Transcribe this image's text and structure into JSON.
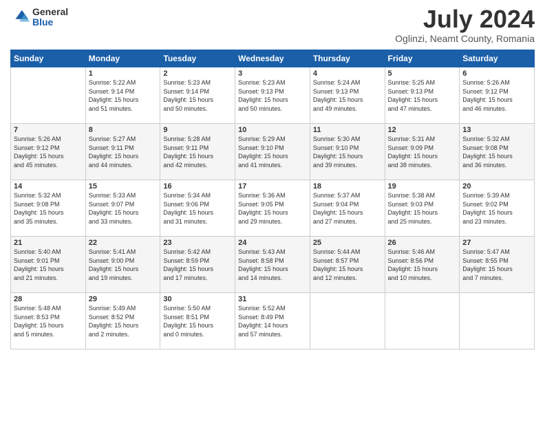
{
  "logo": {
    "general": "General",
    "blue": "Blue"
  },
  "title": "July 2024",
  "location": "Oglinzi, Neamt County, Romania",
  "headers": [
    "Sunday",
    "Monday",
    "Tuesday",
    "Wednesday",
    "Thursday",
    "Friday",
    "Saturday"
  ],
  "weeks": [
    [
      {
        "day": "",
        "info": ""
      },
      {
        "day": "1",
        "info": "Sunrise: 5:22 AM\nSunset: 9:14 PM\nDaylight: 15 hours\nand 51 minutes."
      },
      {
        "day": "2",
        "info": "Sunrise: 5:23 AM\nSunset: 9:14 PM\nDaylight: 15 hours\nand 50 minutes."
      },
      {
        "day": "3",
        "info": "Sunrise: 5:23 AM\nSunset: 9:13 PM\nDaylight: 15 hours\nand 50 minutes."
      },
      {
        "day": "4",
        "info": "Sunrise: 5:24 AM\nSunset: 9:13 PM\nDaylight: 15 hours\nand 49 minutes."
      },
      {
        "day": "5",
        "info": "Sunrise: 5:25 AM\nSunset: 9:13 PM\nDaylight: 15 hours\nand 47 minutes."
      },
      {
        "day": "6",
        "info": "Sunrise: 5:26 AM\nSunset: 9:12 PM\nDaylight: 15 hours\nand 46 minutes."
      }
    ],
    [
      {
        "day": "7",
        "info": "Sunrise: 5:26 AM\nSunset: 9:12 PM\nDaylight: 15 hours\nand 45 minutes."
      },
      {
        "day": "8",
        "info": "Sunrise: 5:27 AM\nSunset: 9:11 PM\nDaylight: 15 hours\nand 44 minutes."
      },
      {
        "day": "9",
        "info": "Sunrise: 5:28 AM\nSunset: 9:11 PM\nDaylight: 15 hours\nand 42 minutes."
      },
      {
        "day": "10",
        "info": "Sunrise: 5:29 AM\nSunset: 9:10 PM\nDaylight: 15 hours\nand 41 minutes."
      },
      {
        "day": "11",
        "info": "Sunrise: 5:30 AM\nSunset: 9:10 PM\nDaylight: 15 hours\nand 39 minutes."
      },
      {
        "day": "12",
        "info": "Sunrise: 5:31 AM\nSunset: 9:09 PM\nDaylight: 15 hours\nand 38 minutes."
      },
      {
        "day": "13",
        "info": "Sunrise: 5:32 AM\nSunset: 9:08 PM\nDaylight: 15 hours\nand 36 minutes."
      }
    ],
    [
      {
        "day": "14",
        "info": "Sunrise: 5:32 AM\nSunset: 9:08 PM\nDaylight: 15 hours\nand 35 minutes."
      },
      {
        "day": "15",
        "info": "Sunrise: 5:33 AM\nSunset: 9:07 PM\nDaylight: 15 hours\nand 33 minutes."
      },
      {
        "day": "16",
        "info": "Sunrise: 5:34 AM\nSunset: 9:06 PM\nDaylight: 15 hours\nand 31 minutes."
      },
      {
        "day": "17",
        "info": "Sunrise: 5:36 AM\nSunset: 9:05 PM\nDaylight: 15 hours\nand 29 minutes."
      },
      {
        "day": "18",
        "info": "Sunrise: 5:37 AM\nSunset: 9:04 PM\nDaylight: 15 hours\nand 27 minutes."
      },
      {
        "day": "19",
        "info": "Sunrise: 5:38 AM\nSunset: 9:03 PM\nDaylight: 15 hours\nand 25 minutes."
      },
      {
        "day": "20",
        "info": "Sunrise: 5:39 AM\nSunset: 9:02 PM\nDaylight: 15 hours\nand 23 minutes."
      }
    ],
    [
      {
        "day": "21",
        "info": "Sunrise: 5:40 AM\nSunset: 9:01 PM\nDaylight: 15 hours\nand 21 minutes."
      },
      {
        "day": "22",
        "info": "Sunrise: 5:41 AM\nSunset: 9:00 PM\nDaylight: 15 hours\nand 19 minutes."
      },
      {
        "day": "23",
        "info": "Sunrise: 5:42 AM\nSunset: 8:59 PM\nDaylight: 15 hours\nand 17 minutes."
      },
      {
        "day": "24",
        "info": "Sunrise: 5:43 AM\nSunset: 8:58 PM\nDaylight: 15 hours\nand 14 minutes."
      },
      {
        "day": "25",
        "info": "Sunrise: 5:44 AM\nSunset: 8:57 PM\nDaylight: 15 hours\nand 12 minutes."
      },
      {
        "day": "26",
        "info": "Sunrise: 5:46 AM\nSunset: 8:56 PM\nDaylight: 15 hours\nand 10 minutes."
      },
      {
        "day": "27",
        "info": "Sunrise: 5:47 AM\nSunset: 8:55 PM\nDaylight: 15 hours\nand 7 minutes."
      }
    ],
    [
      {
        "day": "28",
        "info": "Sunrise: 5:48 AM\nSunset: 8:53 PM\nDaylight: 15 hours\nand 5 minutes."
      },
      {
        "day": "29",
        "info": "Sunrise: 5:49 AM\nSunset: 8:52 PM\nDaylight: 15 hours\nand 2 minutes."
      },
      {
        "day": "30",
        "info": "Sunrise: 5:50 AM\nSunset: 8:51 PM\nDaylight: 15 hours\nand 0 minutes."
      },
      {
        "day": "31",
        "info": "Sunrise: 5:52 AM\nSunset: 8:49 PM\nDaylight: 14 hours\nand 57 minutes."
      },
      {
        "day": "",
        "info": ""
      },
      {
        "day": "",
        "info": ""
      },
      {
        "day": "",
        "info": ""
      }
    ]
  ]
}
